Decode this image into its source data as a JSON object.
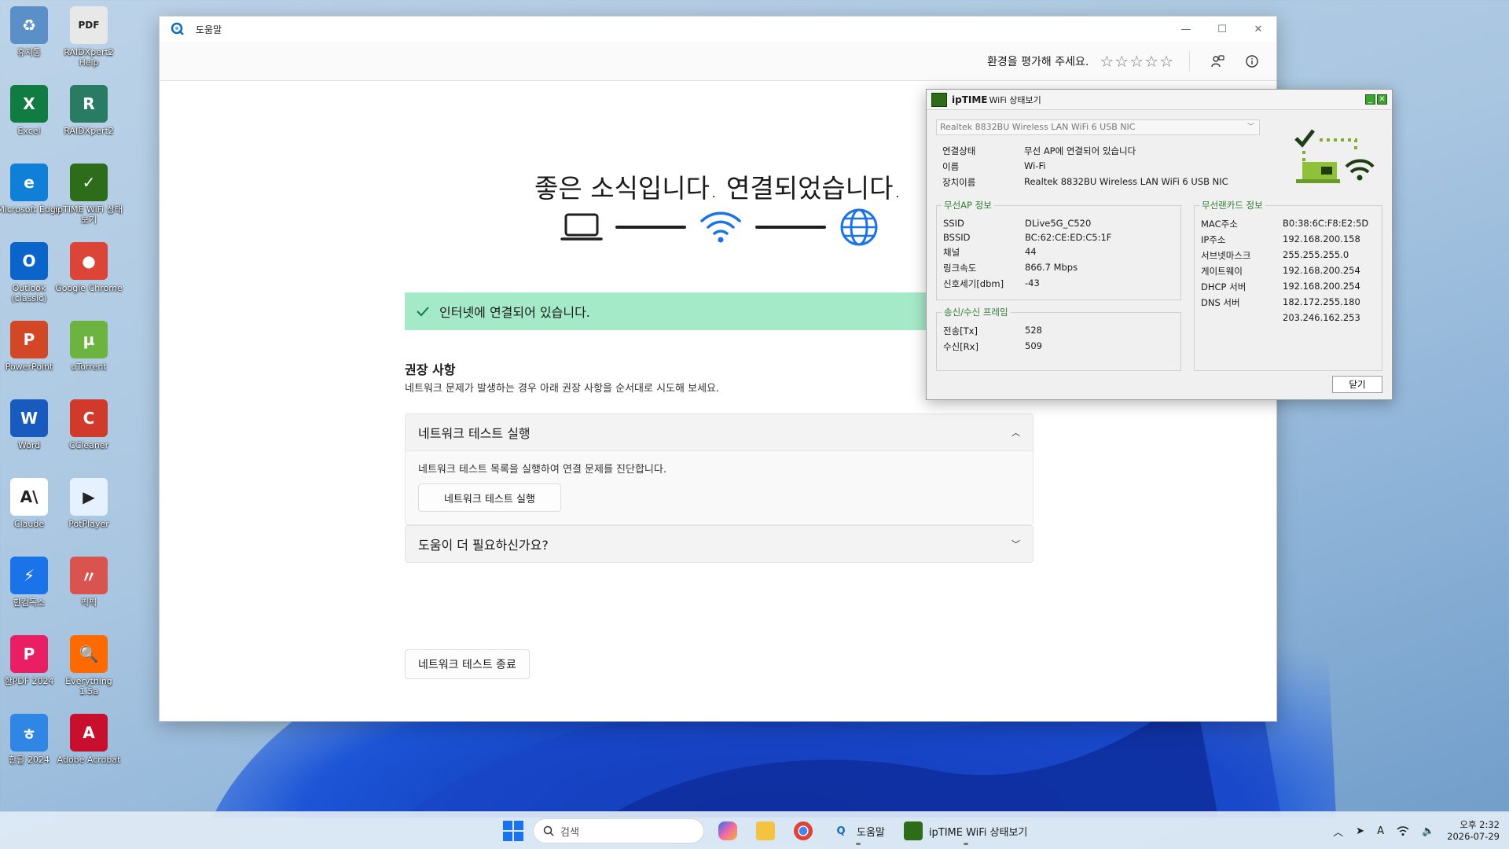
{
  "desktop": {
    "icons": [
      {
        "label": "휴지통",
        "glyph": "♻",
        "color": "#5b8fc7"
      },
      {
        "label": "RAIDXpert2 Help",
        "glyph": "PDF",
        "color": "#e8e8e8"
      },
      {
        "label": "Excel",
        "glyph": "X",
        "color": "#107c41"
      },
      {
        "label": "RAIDXpert2",
        "glyph": "R",
        "color": "#2a7b63"
      },
      {
        "label": "Microsoft Edge",
        "glyph": "e",
        "color": "#0f7fd8"
      },
      {
        "label": "ipTIME WiFi 상태보기",
        "glyph": "✓",
        "color": "#2d6d1a"
      },
      {
        "label": "Outlook (classic)",
        "glyph": "O",
        "color": "#0a64c9"
      },
      {
        "label": "Google Chrome",
        "glyph": "●",
        "color": "#db4437"
      },
      {
        "label": "PowerPoint",
        "glyph": "P",
        "color": "#d24726"
      },
      {
        "label": "uTorrent",
        "glyph": "µ",
        "color": "#6cb33f"
      },
      {
        "label": "Word",
        "glyph": "W",
        "color": "#185abd"
      },
      {
        "label": "CCleaner",
        "glyph": "C",
        "color": "#d13a2a"
      },
      {
        "label": "Claude",
        "glyph": "A\\",
        "color": "#ffffff"
      },
      {
        "label": "PotPlayer",
        "glyph": "▶",
        "color": "#e6f1ff"
      },
      {
        "label": "한컴독스",
        "glyph": "⚡",
        "color": "#1a73e8"
      },
      {
        "label": "픽픽",
        "glyph": "〃",
        "color": "#d9534f"
      },
      {
        "label": "한PDF 2024",
        "glyph": "P",
        "color": "#e91e63"
      },
      {
        "label": "Everything 1.5a",
        "glyph": "🔍",
        "color": "#ff6a00"
      },
      {
        "label": "한글 2024",
        "glyph": "ㅎ",
        "color": "#2f86e4"
      },
      {
        "label": "Adobe Acrobat",
        "glyph": "A",
        "color": "#c8102e"
      }
    ]
  },
  "help": {
    "app_title": "도움말",
    "rating_prompt": "환경을 평가해 주세요.",
    "star_glyph": "☆",
    "headline": "좋은 소식입니다. 연결되었습니다.",
    "status_text": "인터넷에 연결되어 있습니다.",
    "rec_title": "권장 사항",
    "rec_subtitle": "네트워크 문제가 발생하는 경우 아래 권장 사항을 순서대로 시도해 보세요.",
    "acc1_title": "네트워크 테스트 실행",
    "acc1_desc": "네트워크 테스트 목록을 실행하여 연결 문제를 진단합니다.",
    "acc1_button": "네트워크 테스트 실행",
    "acc2_title": "도움이 더 필요하신가요?",
    "end_button": "네트워크 테스트 종료"
  },
  "iptime": {
    "brand": "ipTIME",
    "title": "WiFi 상태보기",
    "adapter_select": "Realtek 8832BU Wireless LAN WiFi 6 USB NIC",
    "conn_rows": [
      {
        "k": "연결상태",
        "v": "무선 AP에 연결되어 있습니다"
      },
      {
        "k": "이름",
        "v": "Wi-Fi"
      },
      {
        "k": "장치이름",
        "v": "Realtek 8832BU Wireless LAN WiFi 6 USB NIC"
      }
    ],
    "ap_group": "무선AP 정보",
    "ap_rows": [
      {
        "k": "SSID",
        "v": "DLive5G_C520"
      },
      {
        "k": "BSSID",
        "v": "BC:62:CE:ED:C5:1F"
      },
      {
        "k": "채널",
        "v": "44"
      },
      {
        "k": "링크속도",
        "v": "866.7 Mbps"
      },
      {
        "k": "신호세기[dbm]",
        "v": "-43"
      }
    ],
    "frame_group": "송신/수신 프레임",
    "frame_rows": [
      {
        "k": "전송[Tx]",
        "v": "528"
      },
      {
        "k": "수신[Rx]",
        "v": "509"
      }
    ],
    "card_group": "무선랜카드 정보",
    "card_rows": [
      {
        "k": "MAC주소",
        "v": "B0:38:6C:F8:E2:5D"
      },
      {
        "k": "IP주소",
        "v": "192.168.200.158"
      },
      {
        "k": "서브넷마스크",
        "v": "255.255.255.0"
      },
      {
        "k": "게이트웨이",
        "v": "192.168.200.254"
      },
      {
        "k": "DHCP 서버",
        "v": "192.168.200.254"
      },
      {
        "k": "DNS 서버",
        "v": "182.172.255.180"
      },
      {
        "k": "",
        "v": "203.246.162.253"
      }
    ],
    "close_button": "닫기"
  },
  "taskbar": {
    "search_placeholder": "검색",
    "app_help": "도움말",
    "app_iptime": "ipTIME WiFi 상태보기",
    "clock_period_time": "오후 2:32",
    "clock_date": "2026-07-29"
  },
  "colors": {
    "success_bar": "#a5eac8",
    "link_blue": "#1a73e8",
    "iptime_green": "#2d6d1a",
    "group_title_green": "#2e7d32"
  }
}
